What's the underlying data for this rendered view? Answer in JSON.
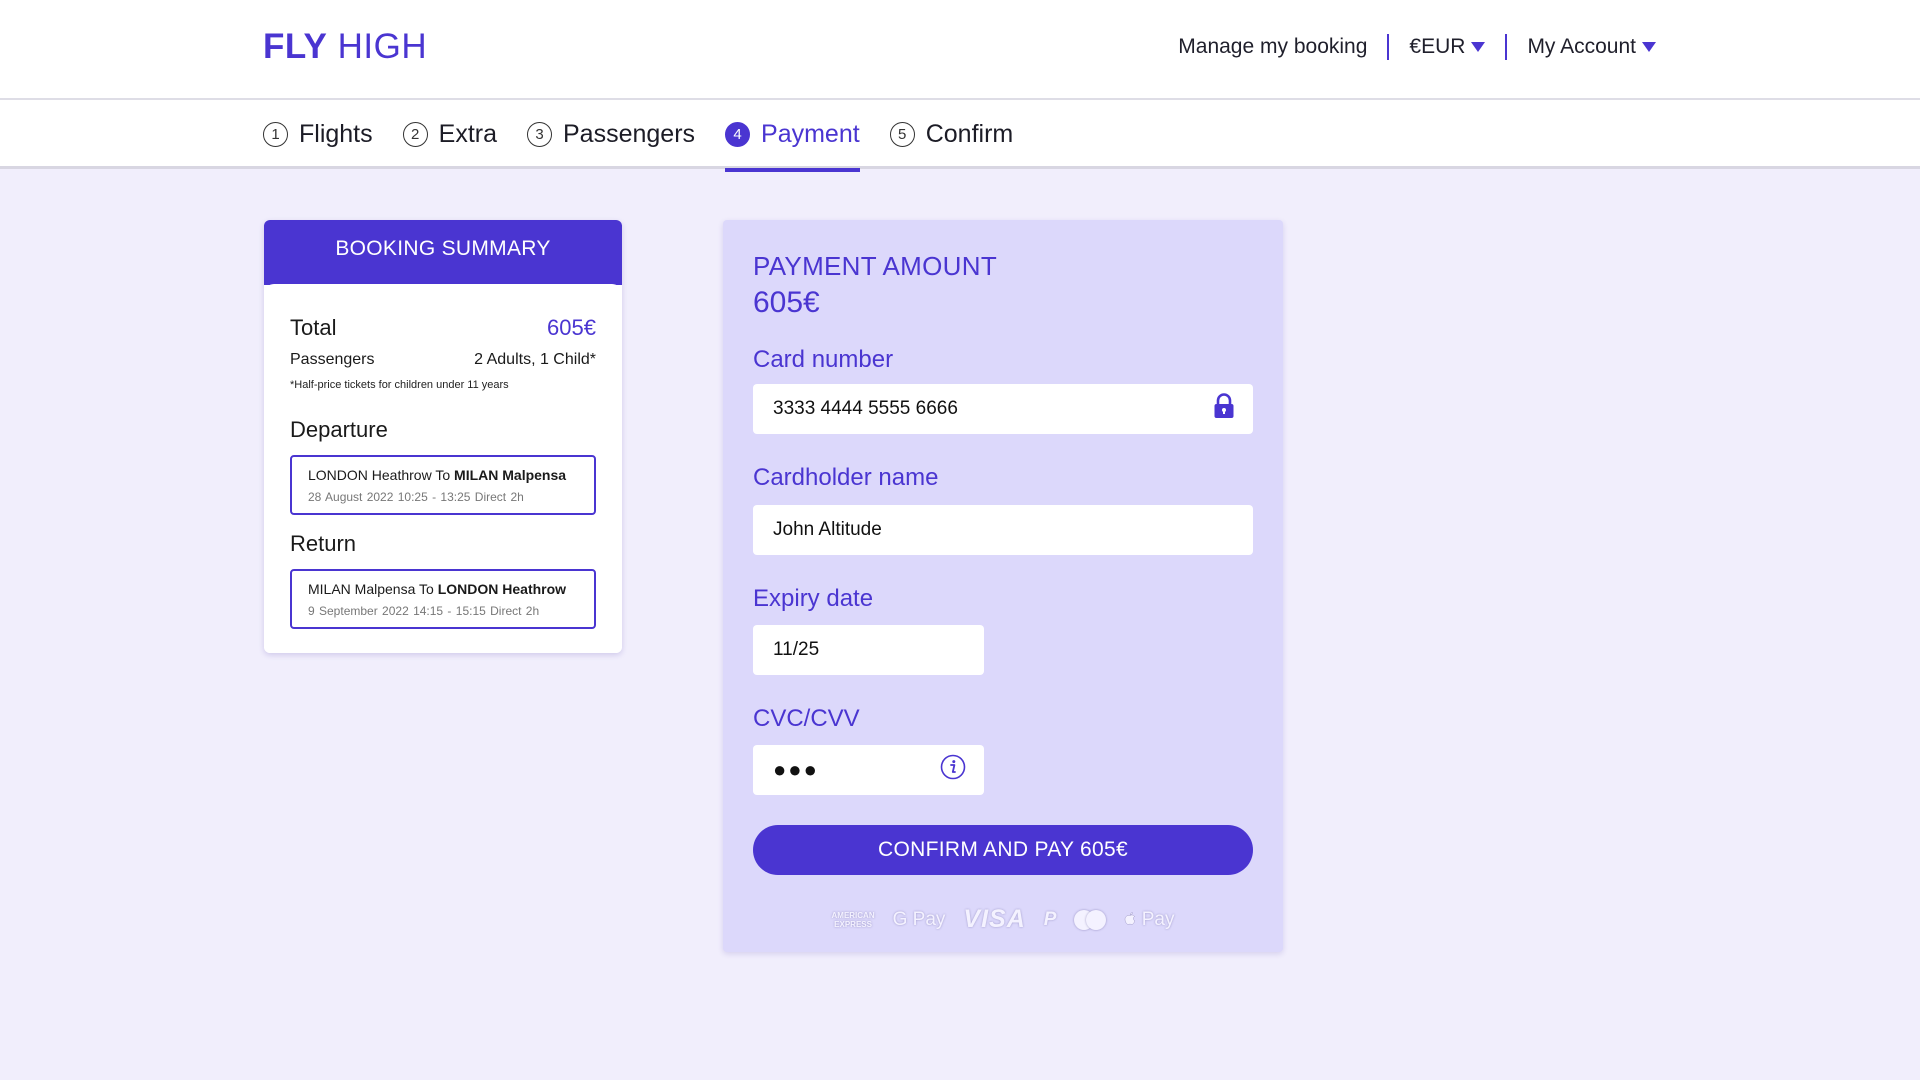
{
  "brand": {
    "logo_bold": "FLY",
    "logo_light": "HIGH",
    "accent": "#4a35d1"
  },
  "nav": {
    "manage": "Manage my booking",
    "currency": "€EUR",
    "account": "My Account"
  },
  "steps": [
    {
      "num": "1",
      "label": "Flights"
    },
    {
      "num": "2",
      "label": "Extra"
    },
    {
      "num": "3",
      "label": "Passengers"
    },
    {
      "num": "4",
      "label": "Payment",
      "active": true
    },
    {
      "num": "5",
      "label": "Confirm"
    }
  ],
  "summary": {
    "title": "BOOKING SUMMARY",
    "total_label": "Total",
    "total_value": "605€",
    "passengers_label": "Passengers",
    "passengers_value": "2 Adults, 1 Child*",
    "note": "*Half-price tickets for children under 11 years",
    "departure": {
      "title": "Departure",
      "from": "LONDON Heathrow",
      "to_word": "To",
      "to": "MILAN Malpensa",
      "details": "28 August 2022  10:25 - 13:25  Direct 2h"
    },
    "return": {
      "title": "Return",
      "from": "MILAN Malpensa",
      "to_word": "To",
      "to": "LONDON Heathrow",
      "details": "9 September 2022  14:15 - 15:15  Direct 2h"
    }
  },
  "payment": {
    "title": "PAYMENT AMOUNT",
    "amount": "605€",
    "card_label": "Card number",
    "card_value": "3333 4444 5555 6666",
    "name_label": "Cardholder name",
    "name_value": "John Altitude",
    "expiry_label": "Expiry date",
    "expiry_value": "11/25",
    "cvc_label": "CVC/CVV",
    "cvc_value": "●●●",
    "button": "CONFIRM AND PAY 605€",
    "methods": {
      "amex_line1": "AMERICAN",
      "amex_line2": "EXPRESS",
      "gpay": "G Pay",
      "visa": "VISA",
      "paypal": "P",
      "applepay": "Pay"
    }
  }
}
